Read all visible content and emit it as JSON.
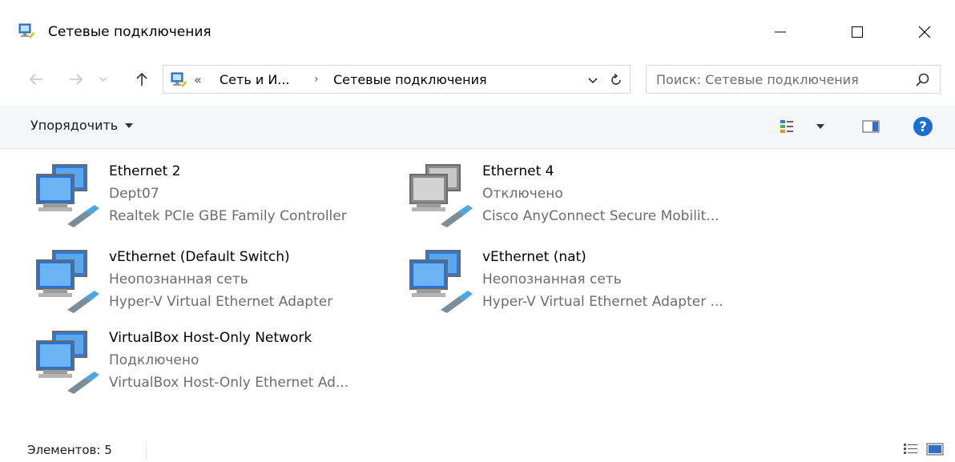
{
  "window": {
    "title": "Сетевые подключения",
    "icons": {
      "app": "network-connections-icon",
      "minimize": "minimize-icon",
      "maximize": "maximize-icon",
      "close": "close-icon"
    }
  },
  "nav": {
    "icons": {
      "back": "arrow-left-icon",
      "forward": "arrow-right-icon",
      "recent": "chevron-down-icon",
      "up": "arrow-up-icon"
    },
    "address": {
      "overflow": "«",
      "crumbs": [
        "Сеть и И...",
        "Сетевые подключения"
      ],
      "separator": "›"
    },
    "search": {
      "placeholder": "Поиск: Сетевые подключения"
    }
  },
  "toolbar": {
    "organize_label": "Упорядочить"
  },
  "connections": [
    {
      "name": "Ethernet 2",
      "status": "Dept07",
      "device": "Realtek PCIe GBE Family Controller",
      "enabled": true
    },
    {
      "name": "Ethernet 4",
      "status": "Отключено",
      "device": "Cisco AnyConnect Secure Mobilit...",
      "enabled": false
    },
    {
      "name": "vEthernet (Default Switch)",
      "status": "Неопознанная сеть",
      "device": "Hyper-V Virtual Ethernet Adapter",
      "enabled": true
    },
    {
      "name": "vEthernet (nat)",
      "status": "Неопознанная сеть",
      "device": "Hyper-V Virtual Ethernet Adapter ...",
      "enabled": true
    },
    {
      "name": "VirtualBox Host-Only Network",
      "status": "Подключено",
      "device": "VirtualBox Host-Only Ethernet Ad...",
      "enabled": true
    }
  ],
  "statusbar": {
    "count_text": "Элементов: 5"
  },
  "colors": {
    "accent": "#1a73d0",
    "help": "#1a6fd1",
    "muted_text": "#6d6d6d",
    "cmdbar_bg": "#f5f6f7"
  }
}
